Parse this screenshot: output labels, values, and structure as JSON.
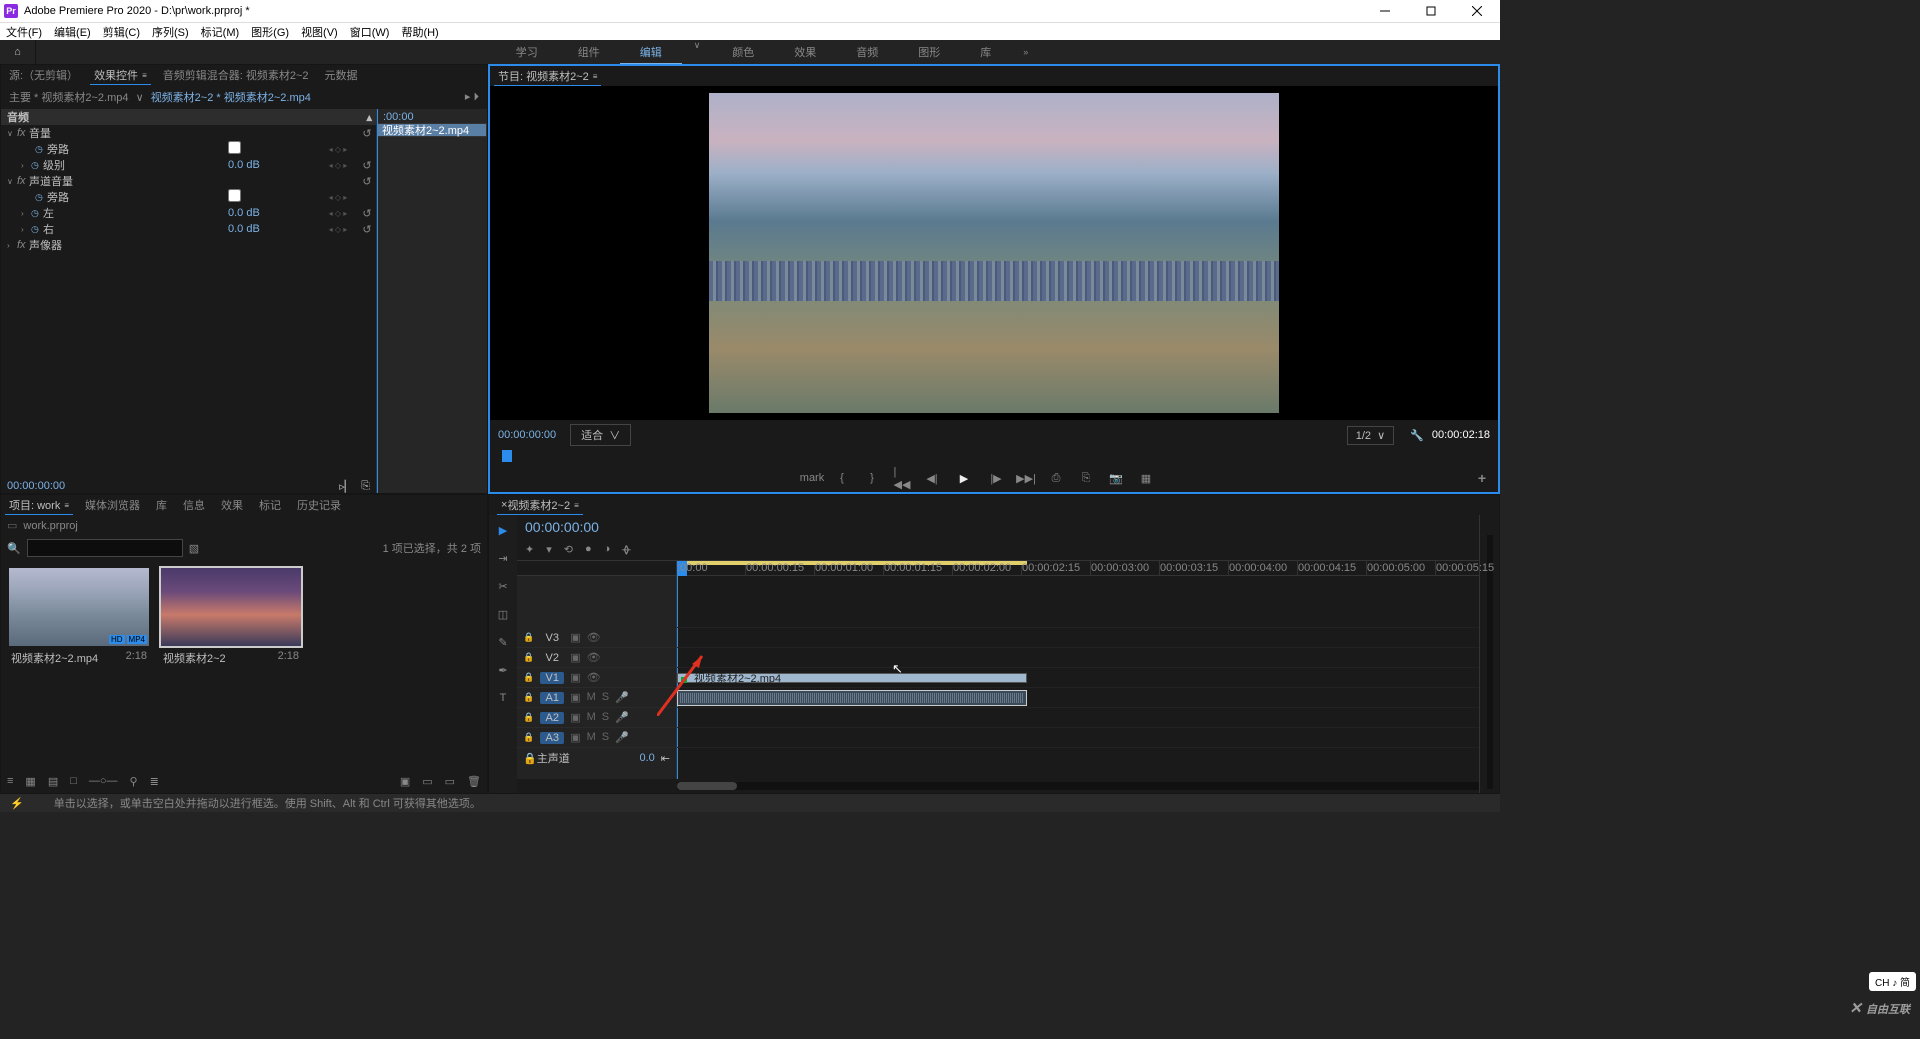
{
  "titlebar": {
    "logo": "Pr",
    "title": "Adobe Premiere Pro 2020 - D:\\pr\\work.prproj *"
  },
  "menus": [
    "文件(F)",
    "编辑(E)",
    "剪辑(C)",
    "序列(S)",
    "标记(M)",
    "图形(G)",
    "视图(V)",
    "窗口(W)",
    "帮助(H)"
  ],
  "workspaces": {
    "items": [
      "学习",
      "组件",
      "编辑",
      "颜色",
      "效果",
      "音频",
      "图形",
      "库"
    ],
    "active_index": 2,
    "overflow": "»"
  },
  "source_panel": {
    "tabs": [
      "源:（无剪辑）",
      "效果控件",
      "音频剪辑混合器: 视频素材2~2",
      "元数据"
    ],
    "active": 1,
    "crumb_main": "主要 * 视频素材2~2.mp4",
    "crumb_link": "视频素材2~2 * 视频素材2~2.mp4",
    "mini_tc": ":00:00",
    "mini_clip": "视频素材2~2.mp4",
    "section_audio": "音频",
    "fx_volume": "音量",
    "p_bypass": "旁路",
    "p_level": "级别",
    "p_level_val": "0.0 dB",
    "fx_channel": "声道音量",
    "p_left": "左",
    "p_left_val": "0.0 dB",
    "p_right": "右",
    "p_right_val": "0.0 dB",
    "fx_panner": "声像器",
    "footer_tc": "00:00:00:00"
  },
  "program": {
    "title": "节目: 视频素材2~2",
    "tc": "00:00:00:00",
    "fit": "适合",
    "res": "1/2",
    "dur": "00:00:02:18",
    "transport_icons": [
      "mark",
      "{",
      "}",
      "|◀◀",
      "◀|",
      "▶",
      "|▶",
      "▶▶|",
      "⎙",
      "⎘",
      "📷",
      "▦"
    ],
    "plus": "+"
  },
  "project": {
    "tabs": [
      "项目: work",
      "媒体浏览器",
      "库",
      "信息",
      "效果",
      "标记",
      "历史记录"
    ],
    "active": 0,
    "crumb": "work.prproj",
    "search_placeholder": "",
    "status": "1 项已选择，共 2 项",
    "clips": [
      {
        "name": "视频素材2~2.mp4",
        "dur": "2:18",
        "badges": [
          "HD",
          "MP4"
        ]
      },
      {
        "name": "视频素材2~2",
        "dur": "2:18",
        "badges": []
      }
    ],
    "selected_index": 1,
    "bottom_icons": [
      "≡",
      "▦",
      "▤",
      "□",
      "—○—",
      "⚲",
      "≣",
      "▣",
      "▭",
      "▭",
      "🗑"
    ]
  },
  "timeline": {
    "title": "视频素材2~2",
    "tc": "00:00:00:00",
    "opt_icons": [
      "✦",
      "▾",
      "⟲",
      "●",
      "◑",
      "ᚖ"
    ],
    "ticks": [
      ":00:00",
      "00:00:00:15",
      "00:00:01:00",
      "00:00:01:15",
      "00:00:02:00",
      "00:00:02:15",
      "00:00:03:00",
      "00:00:03:15",
      "00:00:04:00",
      "00:00:04:15",
      "00:00:05:00",
      "00:00:05:15"
    ],
    "vtracks": [
      {
        "name": "V3",
        "toggled": false
      },
      {
        "name": "V2",
        "toggled": false
      },
      {
        "name": "V1",
        "toggled": true
      }
    ],
    "atracks": [
      {
        "name": "A1",
        "toggled": true
      },
      {
        "name": "A2",
        "toggled": true
      },
      {
        "name": "A3",
        "toggled": true
      }
    ],
    "master_label": "主声道",
    "master_val": "0.0",
    "clip_label": "视频素材2~2.mp4",
    "tool_icons": [
      "▶",
      "⇥",
      "✂",
      "◫",
      "✎",
      "✒",
      "T"
    ]
  },
  "status": {
    "hint": "单击以选择，或单击空白处并拖动以进行框选。使用 Shift、Alt 和 Ctrl 可获得其他选项。"
  },
  "ime": "CH ♪ 简",
  "watermark": "自由互联"
}
